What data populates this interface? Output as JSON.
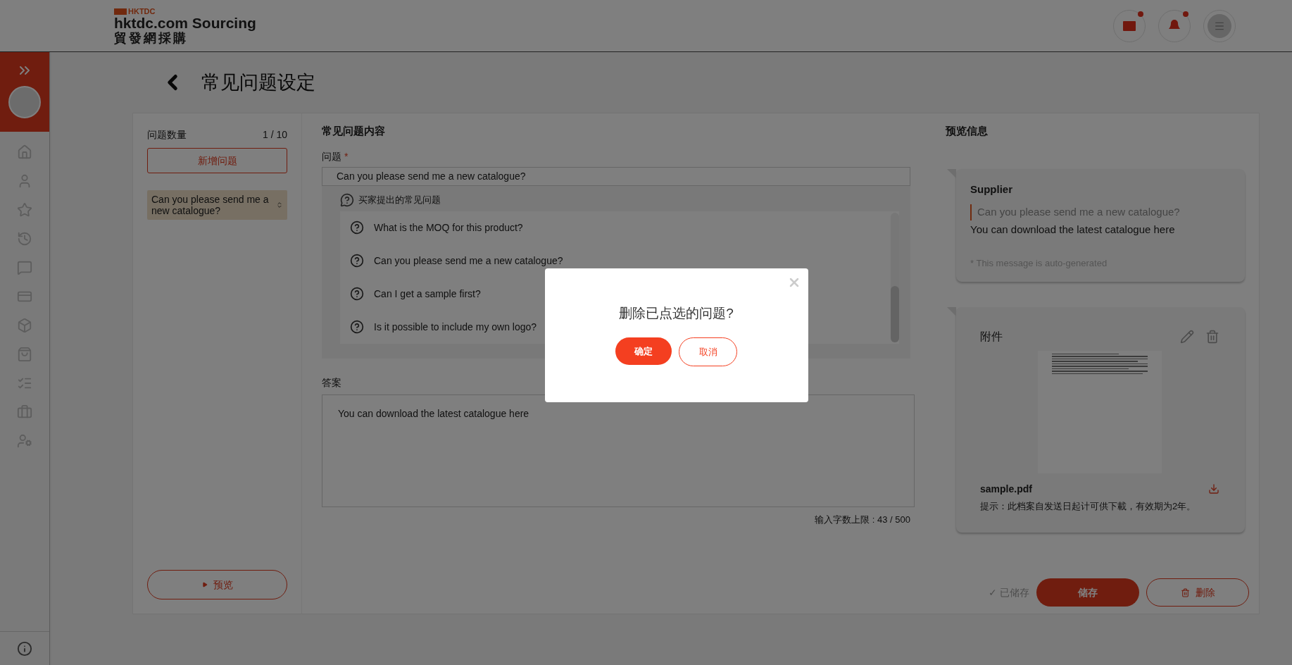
{
  "header": {
    "logo_mark": "HKTDC",
    "logo_title": "hktdc.com Sourcing",
    "logo_subtitle": "貿發網採購"
  },
  "page": {
    "title": "常见问题设定"
  },
  "question_list": {
    "label": "问题数量",
    "count": "1 / 10",
    "add_button": "新增问题",
    "items": [
      {
        "text": "Can you please send me a new catalogue?",
        "selected": true
      }
    ],
    "preview_button": "预览"
  },
  "editor": {
    "heading": "常见问题内容",
    "question_label": "问题",
    "required_mark": "*",
    "question_value": "Can you please send me a new catalogue?",
    "suggestions_title": "买家提出的常见问题",
    "suggestions": [
      "What is the MOQ for this product?",
      "Can you please send me a new catalogue?",
      "Can I get a sample first?",
      "Is it possible to include my own logo?"
    ],
    "answer_label": "答案",
    "answer_value": "You can download the latest catalogue here",
    "counter": "输入字数上限 : 43 / 500"
  },
  "preview": {
    "heading": "预览信息",
    "sender": "Supplier",
    "quoted_question": "Can you please send me a new catalogue?",
    "answer": "You can download the latest catalogue here",
    "note": "* This message is auto-generated",
    "attachment": {
      "title": "附件",
      "file_name": "sample.pdf",
      "hint": "提示：此档案自发送日起计可供下載，有效期为2年。"
    }
  },
  "actions": {
    "status": "✓ 已储存",
    "save": "储存",
    "delete": "删除"
  },
  "dialog": {
    "message": "删除已点选的问题?",
    "confirm": "确定",
    "cancel": "取消"
  }
}
